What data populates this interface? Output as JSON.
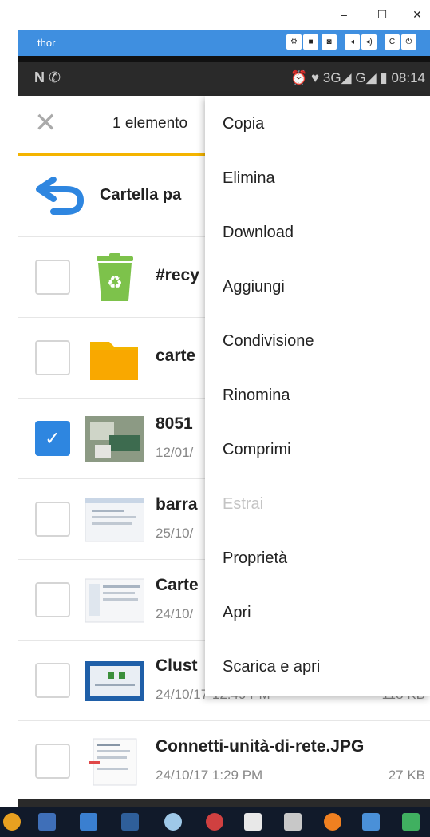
{
  "window": {
    "device_name": "thor",
    "controls": {
      "minimize": "–",
      "maximize": "☐",
      "close": "✕"
    },
    "toolbar_buttons": [
      "⚙",
      "■",
      "◙",
      "◂",
      "◂)",
      "C",
      "⏻"
    ]
  },
  "status_bar": {
    "left_icons": "N ✆",
    "right_text": "⏰ ♥ 3G◢ G◢ ▮ 08:14"
  },
  "app_bar": {
    "close_symbol": "✕",
    "selection_count": "1 elemento"
  },
  "back_row": {
    "label": "Cartella pa"
  },
  "files": [
    {
      "name": "#recy",
      "date": "",
      "size": "",
      "checked": false,
      "icon": "recycle-bin-icon"
    },
    {
      "name": "carte",
      "date": "",
      "size": "",
      "checked": false,
      "icon": "folder-icon"
    },
    {
      "name": "8051",
      "date": "12/01/",
      "size": "",
      "checked": true,
      "icon": "photo-thumbnail"
    },
    {
      "name": "barra",
      "date": "25/10/",
      "size": "",
      "checked": false,
      "icon": "screenshot-thumbnail"
    },
    {
      "name": "Carte",
      "date": "24/10/",
      "size": "",
      "checked": false,
      "icon": "screenshot-thumbnail"
    },
    {
      "name": "Clust",
      "date": "24/10/17 12:49 PM",
      "size": "118 KB",
      "checked": false,
      "icon": "screenshot-thumbnail"
    },
    {
      "name": "Connetti-unità-di-rete.JPG",
      "date": "24/10/17 1:29 PM",
      "size": "27 KB",
      "checked": false,
      "icon": "screenshot-thumbnail"
    }
  ],
  "context_menu": {
    "items": [
      {
        "label": "Copia",
        "enabled": true
      },
      {
        "label": "Elimina",
        "enabled": true
      },
      {
        "label": "Download",
        "enabled": true
      },
      {
        "label": "Aggiungi",
        "enabled": true
      },
      {
        "label": "Condivisione",
        "enabled": true
      },
      {
        "label": "Rinomina",
        "enabled": true
      },
      {
        "label": "Comprimi",
        "enabled": true
      },
      {
        "label": "Estrai",
        "enabled": false
      },
      {
        "label": "Proprietà",
        "enabled": true
      },
      {
        "label": "Apri",
        "enabled": true
      },
      {
        "label": "Scarica e apri",
        "enabled": true
      }
    ]
  },
  "colors": {
    "window_bar": "#3f8fe0",
    "accent": "#f4b400",
    "checkbox_checked": "#2e86e0",
    "folder": "#f4b400",
    "recycle": "#7dc24b"
  }
}
